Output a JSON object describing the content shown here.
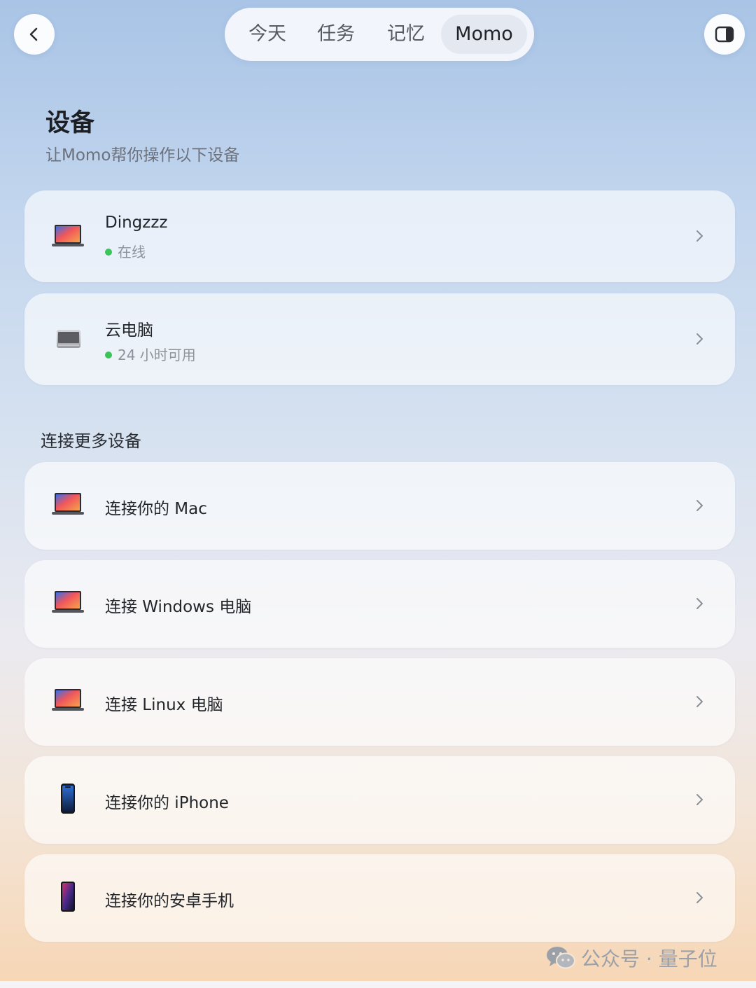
{
  "nav": {
    "tabs": [
      "今天",
      "任务",
      "记忆",
      "Momo"
    ],
    "active_tab": "Momo"
  },
  "page": {
    "title": "设备",
    "subtitle": "让Momo帮你操作以下设备"
  },
  "devices": [
    {
      "name": "Dingzzz",
      "status": "在线",
      "status_color": "#3cc35a",
      "icon": "macbook-icon"
    },
    {
      "name": "云电脑",
      "status": "24 小时可用",
      "status_color": "#3cc35a",
      "icon": "cloud-pc-icon"
    }
  ],
  "connect_section": {
    "title": "连接更多设备",
    "items": [
      {
        "label": "连接你的 Mac",
        "icon": "macbook-icon"
      },
      {
        "label": "连接 Windows 电脑",
        "icon": "laptop-icon"
      },
      {
        "label": "连接 Linux 电脑",
        "icon": "laptop-icon"
      },
      {
        "label": "连接你的 iPhone",
        "icon": "iphone-icon"
      },
      {
        "label": "连接你的安卓手机",
        "icon": "android-phone-icon"
      }
    ]
  },
  "watermark": {
    "text": "公众号 · 量子位",
    "icon": "wechat-icon"
  },
  "icons": {
    "back": "chevron-left-icon",
    "panel": "sidebar-toggle-icon",
    "row_arrow": "chevron-right-icon"
  },
  "colors": {
    "online": "#3cc35a",
    "active_tab_bg": "#e4e8f0"
  }
}
